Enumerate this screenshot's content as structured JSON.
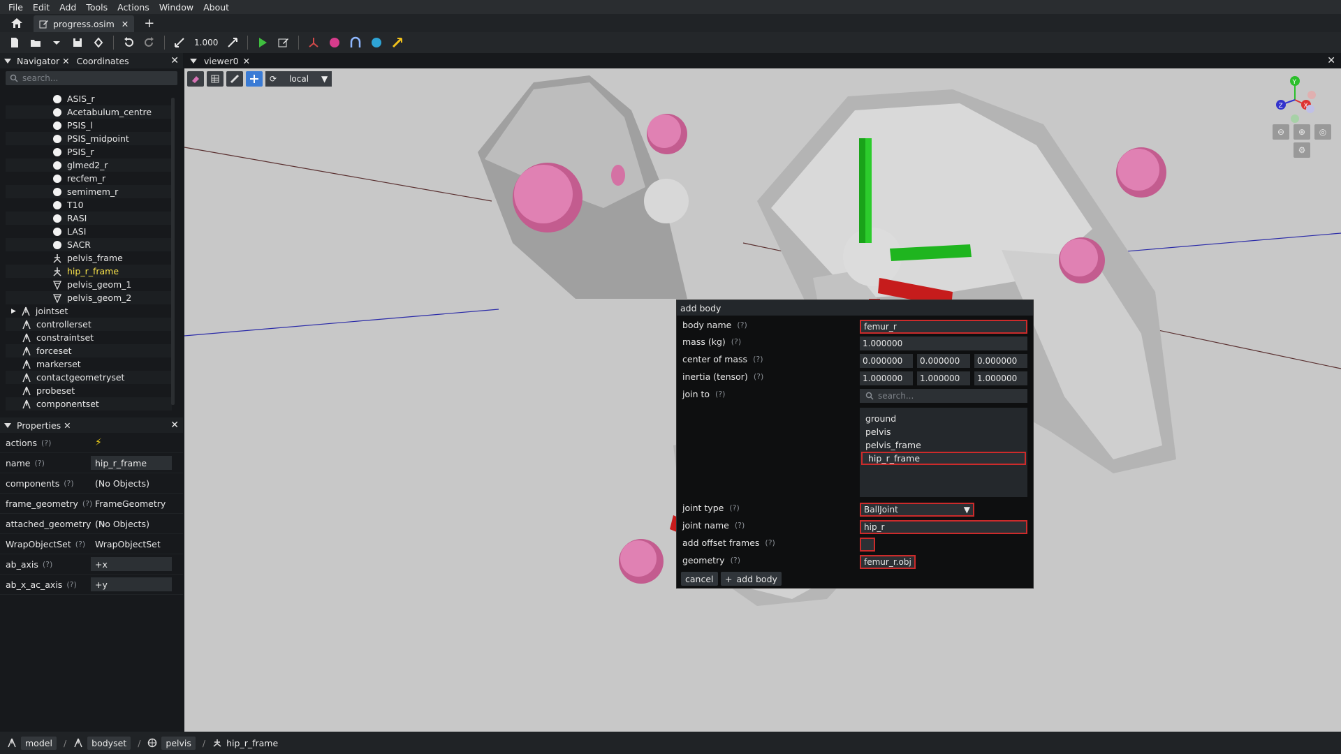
{
  "menu": [
    "File",
    "Edit",
    "Add",
    "Tools",
    "Actions",
    "Window",
    "About"
  ],
  "tab": {
    "label": "progress.osim"
  },
  "toolbar": {
    "scale": "1.000"
  },
  "navigator": {
    "title": "Navigator",
    "coordinates_title": "Coordinates",
    "search_placeholder": "search...",
    "items": [
      {
        "label": "ASIS_r",
        "icon": "marker-icon"
      },
      {
        "label": "Acetabulum_centre",
        "icon": "marker-icon"
      },
      {
        "label": "PSIS_l",
        "icon": "marker-icon"
      },
      {
        "label": "PSIS_midpoint",
        "icon": "marker-icon"
      },
      {
        "label": "PSIS_r",
        "icon": "marker-icon"
      },
      {
        "label": "glmed2_r",
        "icon": "marker-icon"
      },
      {
        "label": "recfem_r",
        "icon": "marker-icon"
      },
      {
        "label": "semimem_r",
        "icon": "marker-icon"
      },
      {
        "label": "T10",
        "icon": "marker-icon"
      },
      {
        "label": "RASI",
        "icon": "marker-icon"
      },
      {
        "label": "LASI",
        "icon": "marker-icon"
      },
      {
        "label": "SACR",
        "icon": "marker-icon"
      },
      {
        "label": "pelvis_frame",
        "icon": "frame-icon"
      },
      {
        "label": "hip_r_frame",
        "icon": "frame-icon"
      },
      {
        "label": "pelvis_geom_1",
        "icon": "mesh-icon"
      },
      {
        "label": "pelvis_geom_2",
        "icon": "mesh-icon"
      },
      {
        "label": "jointset",
        "icon": "set-icon"
      },
      {
        "label": "controllerset",
        "icon": "set-icon"
      },
      {
        "label": "constraintset",
        "icon": "set-icon"
      },
      {
        "label": "forceset",
        "icon": "set-icon"
      },
      {
        "label": "markerset",
        "icon": "set-icon"
      },
      {
        "label": "contactgeometryset",
        "icon": "set-icon"
      },
      {
        "label": "probeset",
        "icon": "set-icon"
      },
      {
        "label": "componentset",
        "icon": "set-icon"
      }
    ]
  },
  "properties": {
    "title": "Properties",
    "rows": [
      {
        "key": "actions",
        "value": ""
      },
      {
        "key": "name",
        "value": "hip_r_frame"
      },
      {
        "key": "components",
        "value": "(No Objects)"
      },
      {
        "key": "frame_geometry",
        "value": "FrameGeometry"
      },
      {
        "key": "attached_geometry",
        "value": "(No Objects)"
      },
      {
        "key": "WrapObjectSet",
        "value": "WrapObjectSet"
      },
      {
        "key": "ab_axis",
        "value": "+x"
      },
      {
        "key": "ab_x_ac_axis",
        "value": "+y"
      }
    ]
  },
  "viewer": {
    "title": "viewer0",
    "frame_mode": "local"
  },
  "dialog": {
    "title": "add body",
    "body_name_label": "body name",
    "body_name": "femur_r",
    "mass_label": "mass (kg)",
    "mass": "1.000000",
    "com_label": "center of mass",
    "com": [
      "0.000000",
      "0.000000",
      "0.000000"
    ],
    "inertia_label": "inertia (tensor)",
    "inertia": [
      "1.000000",
      "1.000000",
      "1.000000"
    ],
    "join_to_label": "join to",
    "join_search": "search...",
    "join_options": [
      "ground",
      "pelvis",
      "pelvis_frame",
      "hip_r_frame"
    ],
    "joint_type_label": "joint type",
    "joint_type": "BallJoint",
    "joint_name_label": "joint name",
    "joint_name": "hip_r",
    "offset_label": "add offset frames",
    "geometry_label": "geometry",
    "geometry": "femur_r.obj",
    "cancel": "cancel",
    "add": "add body",
    "help": "(?)"
  },
  "breadcrumb": [
    "model",
    "bodyset",
    "pelvis",
    "hip_r_frame"
  ]
}
